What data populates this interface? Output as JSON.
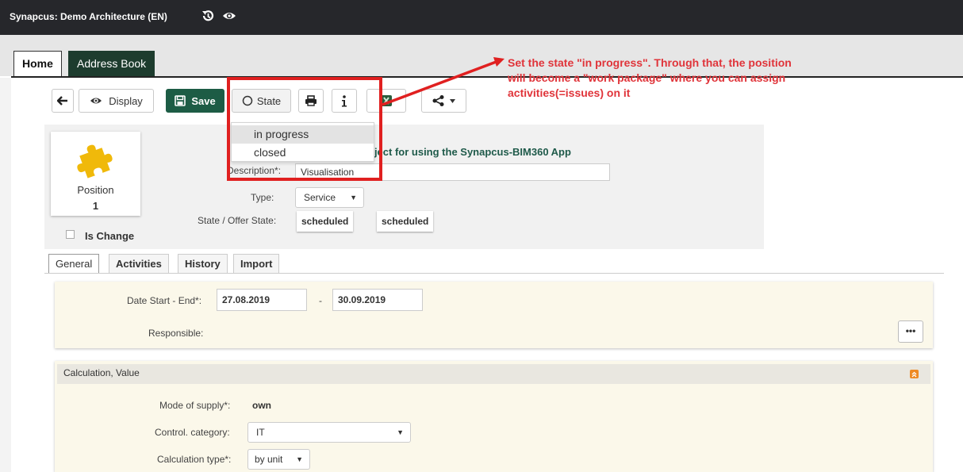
{
  "app": {
    "title": "Synapcus: Demo Architecture (EN)"
  },
  "tabs": [
    "Home",
    "Address Book"
  ],
  "toolbar": {
    "display_label": "Display",
    "save_label": "Save",
    "state_label": "State"
  },
  "state_menu": {
    "items": [
      "in progress",
      "closed"
    ]
  },
  "annotation": {
    "lines": [
      "Set the state \"in progress\". Through that, the position",
      "will become a \"work package\" where you can assign",
      "activities(=issues) on it"
    ]
  },
  "position": {
    "label": "Position",
    "number": "1",
    "is_change_label": "Is Change",
    "project_name": "project for using the Synapcus-BIM360 App",
    "description_label": "Description*:",
    "description_value": "Visualisation",
    "type_label": "Type:",
    "type_value": "Service",
    "state_label": "State / Offer State:",
    "state_value": "scheduled",
    "offer_state_value": "scheduled"
  },
  "subtabs": [
    "General",
    "Activities",
    "History",
    "Import"
  ],
  "general": {
    "date_label": "Date Start - End*:",
    "date_start": "27.08.2019",
    "date_sep": "-",
    "date_end": "30.09.2019",
    "responsible_label": "Responsible:",
    "responsible_button": "•••"
  },
  "calculation": {
    "title": "Calculation, Value",
    "mode_label": "Mode of supply*:",
    "mode_value": "own",
    "control_label": "Control. category:",
    "control_value": "IT",
    "calc_type_label": "Calculation type*:",
    "calc_type_value": "by unit"
  },
  "colors": {
    "topbar": "#26272b",
    "save_button": "#1d5c45",
    "annotation_red": "#e02020",
    "panel_bg": "#fbf8ea"
  }
}
